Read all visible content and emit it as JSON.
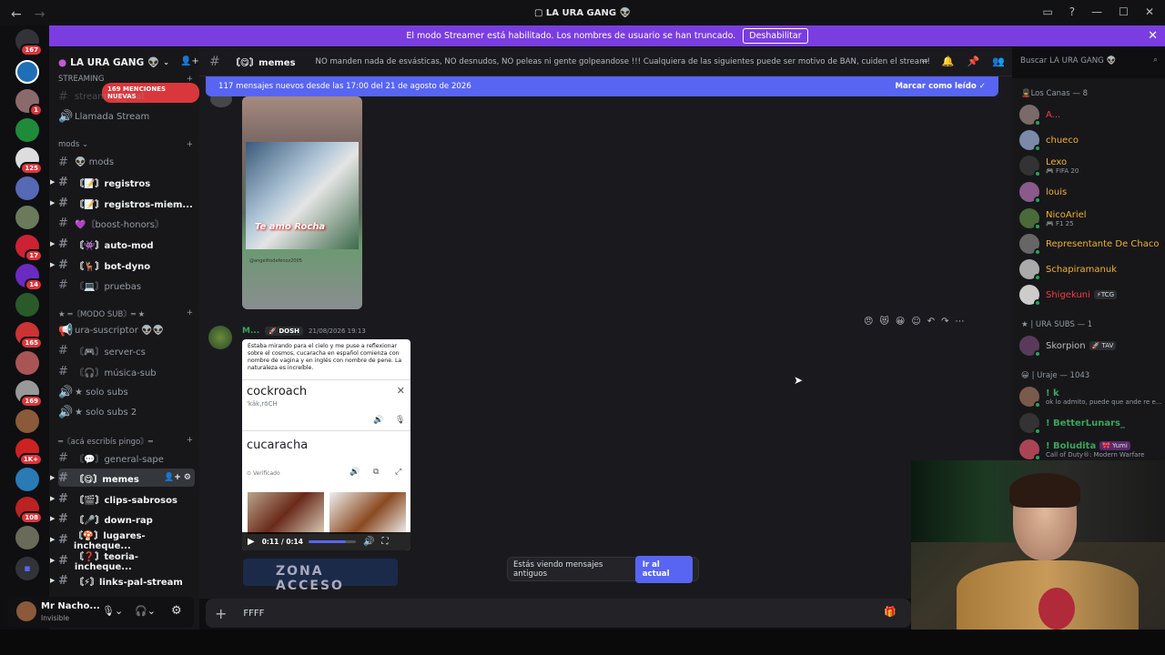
{
  "window": {
    "title": "LA URA GANG",
    "title_icon": "alien-icon"
  },
  "streamer_banner": {
    "text": "El modo Streamer está habilitado. Los nombres de usuario se han truncado.",
    "button": "Deshabilitar"
  },
  "guild_badges": [
    "167",
    "1",
    "125",
    "17",
    "14",
    "165",
    "169",
    "1K+",
    "108"
  ],
  "server": {
    "name": "LA URA GANG",
    "new_mentions": "169 MENCIONES NUEVAS"
  },
  "sidebar": {
    "top_items": [
      {
        "name": "STREAMING",
        "type": "category"
      },
      {
        "name": "streaming_chat",
        "type": "text"
      },
      {
        "name": "Llamada Stream",
        "type": "voice"
      }
    ],
    "cat_mods": "mods",
    "mods_channels": [
      {
        "label": "👽 mods",
        "bold": false
      },
      {
        "label": "〘📝〙registros",
        "bold": true
      },
      {
        "label": "〘📝〙registros-miem...",
        "bold": true
      },
      {
        "label": "💜〘boost-honors〙",
        "bold": false
      },
      {
        "label": "〘👾〙auto-mod",
        "bold": true
      },
      {
        "label": "〘🦌〙bot-dyno",
        "bold": true
      },
      {
        "label": "〘💻〙pruebas",
        "bold": false
      }
    ],
    "cat_sub": "★ ═〘MODO SUB〙═ ★",
    "sub_channels": [
      {
        "label": "ura-suscriptor 👽👽",
        "bold": false,
        "voice": false
      },
      {
        "label": "〘🎮〙server-cs",
        "bold": false,
        "voice": false
      },
      {
        "label": "〘🎧〙música-sub",
        "bold": false,
        "voice": false
      },
      {
        "label": "★ solo subs",
        "bold": false,
        "voice": true
      },
      {
        "label": "★ solo subs 2",
        "bold": false,
        "voice": true
      }
    ],
    "cat_write": "═〘acá escribís pingo〙═",
    "write_channels": [
      {
        "label": "〘💬〙general-sape",
        "bold": false
      },
      {
        "label": "〘😋〙memes",
        "bold": true,
        "active": true
      },
      {
        "label": "〘🎬〙clips-sabrosos",
        "bold": true
      },
      {
        "label": "〘🎤〙down-rap",
        "bold": true
      },
      {
        "label": "〘🍄〙lugares-incheque...",
        "bold": true
      },
      {
        "label": "〘❓〙teoria-incheque...",
        "bold": true
      },
      {
        "label": "〘⚡〙links-pal-stream",
        "bold": true
      }
    ]
  },
  "user_panel": {
    "name": "Mr Nacho...",
    "status": "Invisible"
  },
  "channel_header": {
    "name": "〘😋〙memes",
    "topic": "NO manden nada de esvásticas, NO desnudos, NO peleas ni gente golpeandose !!! Cualquiera de las siguientes puede ser motivo de BAN, cuiden el stream!"
  },
  "new_messages_bar": {
    "text": "117 mensajes nuevos desde las 17:00 del 21 de agosto de 2026",
    "action": "Marcar como leído"
  },
  "message": {
    "author": "M...",
    "tag": "DOSH",
    "timestamp": "21/08/2026 19:13",
    "image_caption": "@angelitodefenoz2005",
    "image_text": "Te amo Rocha",
    "card_text": "Estaba mirando para el cielo y me puse a reflexionar sobre el cosmos, cucaracha en español comienza con nombre de vagina y en inglés con nombre de pene. La naturaleza es increíble.",
    "word_en": "cockroach",
    "phonetic": "'käk,rōCH",
    "word_es": "cucaracha",
    "verified": "Verificado",
    "video_time": "0:11 / 0:14",
    "video_progress": 0.79
  },
  "next_thumb_text": "ZONA ACCESO",
  "old_messages": {
    "text": "Estás viendo mensajes antiguos",
    "button": "Ir al actual"
  },
  "input": {
    "value": "FFFF"
  },
  "search": {
    "placeholder": "Buscar LA URA GANG 👽"
  },
  "members": {
    "group1": "Los Canas — 8",
    "group1_members": [
      {
        "name": "A...",
        "color": "#f23f43",
        "sub": ""
      },
      {
        "name": "chueco",
        "color": "#f0b232",
        "sub": ""
      },
      {
        "name": "Lexo",
        "color": "#f0b232",
        "sub": "🎮 FIFA 20"
      },
      {
        "name": "louis",
        "color": "#f0b232",
        "sub": ""
      },
      {
        "name": "NicoAriel",
        "color": "#f0b232",
        "sub": "🎮 F1 25"
      },
      {
        "name": "Representante De Chaco",
        "color": "#f0b232",
        "sub": ""
      },
      {
        "name": "Schapiramanuk",
        "color": "#f0b232",
        "sub": ""
      },
      {
        "name": "Shigekuni",
        "color": "#f23f43",
        "sub": "",
        "badge": "⚡TCG"
      }
    ],
    "group2": "★ | URA SUBS — 1",
    "group2_members": [
      {
        "name": "Skorpion",
        "color": "#b5bac1",
        "sub": "",
        "badge": "🚀 TAV"
      }
    ],
    "group3": "😀 | Uraje — 1043",
    "group3_members": [
      {
        "name": "! k",
        "color": "#3ba55c",
        "sub": "ok lo admito, puede que ande re e..."
      },
      {
        "name": "! BetterLunars_",
        "color": "#3ba55c",
        "sub": ""
      },
      {
        "name": "! Boludita",
        "color": "#3ba55c",
        "sub": "Call of Duty®: Modern Warfare",
        "badge": "🎀 Yumi"
      }
    ]
  },
  "colors": {
    "accent": "#5865f2",
    "streamer": "#7a3de0",
    "mention": "#da373c"
  }
}
